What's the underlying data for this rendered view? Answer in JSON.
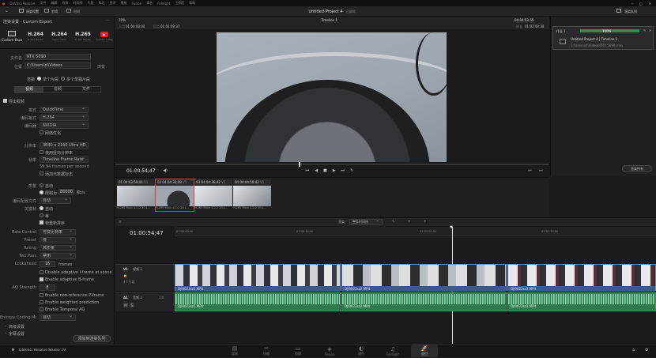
{
  "os_bar": {
    "app": "DaVinci Resolve",
    "menus": [
      "文件",
      "编辑",
      "修剪",
      "时间线",
      "片段",
      "标记",
      "显示",
      "播放",
      "Fusion",
      "调色",
      "Fairlight",
      "工作区",
      "帮助"
    ]
  },
  "toolbar": {
    "render_settings": "渲染设置",
    "clip_settings": "剪辑",
    "timeline": "时间",
    "project_title": "Untitled Project 4",
    "edited": "已编辑",
    "render_queue": "渲染队列"
  },
  "viewer_bar": {
    "zoom": "79%",
    "timeline_name": "Timeline 1",
    "src_tc": "04:04:53:55",
    "in_label": "入点",
    "in_tc": "01:00:00:00",
    "out_label": "出点",
    "out_tc": "01:02:09:37",
    "dur_label": "时长",
    "dur_tc": "01:02:09:38"
  },
  "render_panel": {
    "title": "渲染设置 - Custom Export",
    "presets": [
      {
        "name": "Custom Export",
        "icon": "custom-export-icon"
      },
      {
        "name": "H.264",
        "sub": "H.264 Master"
      },
      {
        "name": "H.264",
        "sub": "Hyper Deck"
      },
      {
        "name": "H.265",
        "sub": "H.265 Master"
      },
      {
        "name": "YouTube",
        "sub": "YouTube 1080p"
      }
    ],
    "filename_label": "文件名",
    "filename": "RTX 5090",
    "location_label": "位置",
    "location": "C:\\Users\\cl\\Videos",
    "browse": "浏览",
    "render_label": "渲染",
    "single_clip": "单个片段",
    "multi_clip": "多个单独片段",
    "tabs": [
      "视频",
      "音频",
      "文件"
    ],
    "export_video": "导出视频",
    "format_label": "格式",
    "format": "QuickTime",
    "codec_label": "编码格式",
    "codec": "H.264",
    "encoder_label": "编码器",
    "encoder": "NVIDIA",
    "network_opt": "网络优化",
    "resolution_label": "分辨率",
    "resolution": "3840 x 2160 Ultra HD",
    "use_vertical": "使用竖向分辨率",
    "framerate_label": "帧率",
    "framerate": "Timeline Frame Rate",
    "fps_note": "59.94 frames per second",
    "chroma_label": "",
    "chroma": "添加元数据标志",
    "quality_label": "质量",
    "quality_auto": "自动",
    "limit_to": "限制为",
    "bitrate": "80000",
    "kbps": "Kb/s",
    "encode_profile_label": "编码配置文件",
    "encode_profile": "自动",
    "keyframes_label": "关键帧",
    "kf_auto": "自动",
    "kf_every": "每",
    "frame_reorder": "帧重新排序",
    "rate_control_label": "Rate Control",
    "rate_control": "可变比特率",
    "preset_label": "Preset",
    "preset": "慢",
    "tuning_label": "Tuning",
    "tuning": "高质量",
    "twopass_label": "Two Pass",
    "twopass": "禁用",
    "lookahead_label": "Lookahead",
    "lookahead": "16",
    "frames": "frames",
    "opt1": "Disable adaptive I-frame at scene cuts",
    "opt2": "Enable adaptive B-frame",
    "aq_label": "AQ Strength",
    "aq": "8",
    "opt3": "Enable non-reference P-frame",
    "opt4": "Enable weighted prediction",
    "opt5": "Enable Temporal AQ",
    "entropy_label": "Entropy Coding Mode",
    "entropy": "自动",
    "adv": "高级设置",
    "subtitle": "字幕设置",
    "add_queue": "添加到渲染队列"
  },
  "player": {
    "timecode": "01:00:54;47"
  },
  "clips": [
    {
      "idx": "01",
      "tc": "04:03:59;04",
      "track": "V1",
      "name": "H.265 Main 4:2:2 10-L..."
    },
    {
      "idx": "02",
      "tc": "04:04:32;08",
      "track": "V1",
      "name": "H.265 Main 4:2:2 10-L..."
    },
    {
      "idx": "03",
      "tc": "04:04:36;42",
      "track": "V1",
      "name": "H.265 Main 4:2:2 10-L..."
    },
    {
      "idx": "04",
      "tc": "04:04:50;42",
      "track": "V1",
      "name": "H.265 Main 4:2:2 10-L..."
    }
  ],
  "timeline": {
    "timecode": "01:00:54;47",
    "mode_label": "渲染",
    "mode": "整条时间线",
    "ruler": [
      "01:00:00;00",
      "01:00:30;00",
      "01:01:00;00",
      "01:01:30;00"
    ],
    "v1": {
      "label": "V1",
      "name": "视频 1",
      "count": "4个片段"
    },
    "a1": {
      "label": "A1",
      "name": "音频 1",
      "level": "2.0"
    },
    "vclips": [
      "DJI0022sz1.MP4",
      "DJI0022sz2.MP4",
      "DJI0022sz3.MP4"
    ],
    "aclips": [
      "DJI0022sz1.MP4",
      "DJI0022sz2.MP4",
      "DJI0022sz3.MP4"
    ]
  },
  "queue": {
    "job": "作业 1",
    "job_status": "100%",
    "project": "Untitled Project 4 | Timeline 1",
    "path": "C:\\Users\\cl\\Videos\\RTX 5090.mov",
    "render_all": "渲染所有"
  },
  "bottom": {
    "app": "DaVinci Resolve Studio 19",
    "pages": [
      {
        "name": "媒体",
        "icon": "media-icon"
      },
      {
        "name": "快编",
        "icon": "cut-icon"
      },
      {
        "name": "剪辑",
        "icon": "edit-icon"
      },
      {
        "name": "Fusion",
        "icon": "fusion-icon"
      },
      {
        "name": "调色",
        "icon": "color-icon"
      },
      {
        "name": "Fairlight",
        "icon": "fairlight-icon"
      },
      {
        "name": "交付",
        "icon": "deliver-icon"
      }
    ]
  }
}
